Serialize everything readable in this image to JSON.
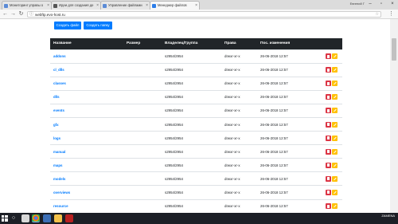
{
  "browser": {
    "tabs": [
      {
        "title": "Мониторинг управы о"
      },
      {
        "title": "Идеи для создания де"
      },
      {
        "title": "Управление файлами"
      },
      {
        "title": "Менеджер файлов"
      }
    ],
    "active_tab": 3,
    "user": "Евгений Г",
    "url": "webftp.evo-host.ru"
  },
  "page": {
    "buttons": {
      "create_file": "Создать файл",
      "create_folder": "Создать папку"
    },
    "table": {
      "columns": [
        "Название",
        "Размер",
        "Владелец/Группа",
        "Права",
        "Пос. изменения"
      ],
      "rows": [
        {
          "name": "addons",
          "size": "",
          "owner": "s2954/2954",
          "perms": "drwxr-xr-x",
          "modified": "26-06-2018 12:57"
        },
        {
          "name": "cl_dlls",
          "size": "",
          "owner": "s2954/2954",
          "perms": "drwxr-xr-x",
          "modified": "26-06-2018 12:57"
        },
        {
          "name": "classes",
          "size": "",
          "owner": "s2954/2954",
          "perms": "drwxr-xr-x",
          "modified": "26-06-2018 12:57"
        },
        {
          "name": "dlls",
          "size": "",
          "owner": "s2954/2954",
          "perms": "drwxr-xr-x",
          "modified": "26-06-2018 12:57"
        },
        {
          "name": "events",
          "size": "",
          "owner": "s2954/2954",
          "perms": "drwxr-xr-x",
          "modified": "26-06-2018 12:57"
        },
        {
          "name": "gfx",
          "size": "",
          "owner": "s2954/2954",
          "perms": "drwxr-xr-x",
          "modified": "26-06-2018 12:57"
        },
        {
          "name": "logs",
          "size": "",
          "owner": "s2954/2954",
          "perms": "drwxr-xr-x",
          "modified": "26-06-2018 12:57"
        },
        {
          "name": "manual",
          "size": "",
          "owner": "s2954/2954",
          "perms": "drwxr-xr-x",
          "modified": "26-06-2018 12:57"
        },
        {
          "name": "maps",
          "size": "",
          "owner": "s2954/2954",
          "perms": "drwxr-xr-x",
          "modified": "26-06-2018 12:57"
        },
        {
          "name": "models",
          "size": "",
          "owner": "s2954/2954",
          "perms": "drwxr-xr-x",
          "modified": "26-06-2018 12:57"
        },
        {
          "name": "overviews",
          "size": "",
          "owner": "s2954/2954",
          "perms": "drwxr-xr-x",
          "modified": "26-06-2018 12:57"
        },
        {
          "name": "resource",
          "size": "",
          "owner": "s2954/2954",
          "perms": "drwxr-xr-x",
          "modified": "26-06-2018 12:57"
        }
      ]
    }
  },
  "colors": {
    "primary": "#007bff",
    "danger": "#dc3545",
    "warning": "#ffc107",
    "table_header": "#212529"
  },
  "taskbar": {
    "tray_watermark": "ZAMENA",
    "icons": [
      "start-icon",
      "search-icon",
      "chrome-icon",
      "explorer-icon",
      "folder-icon",
      "filezilla-icon"
    ]
  }
}
